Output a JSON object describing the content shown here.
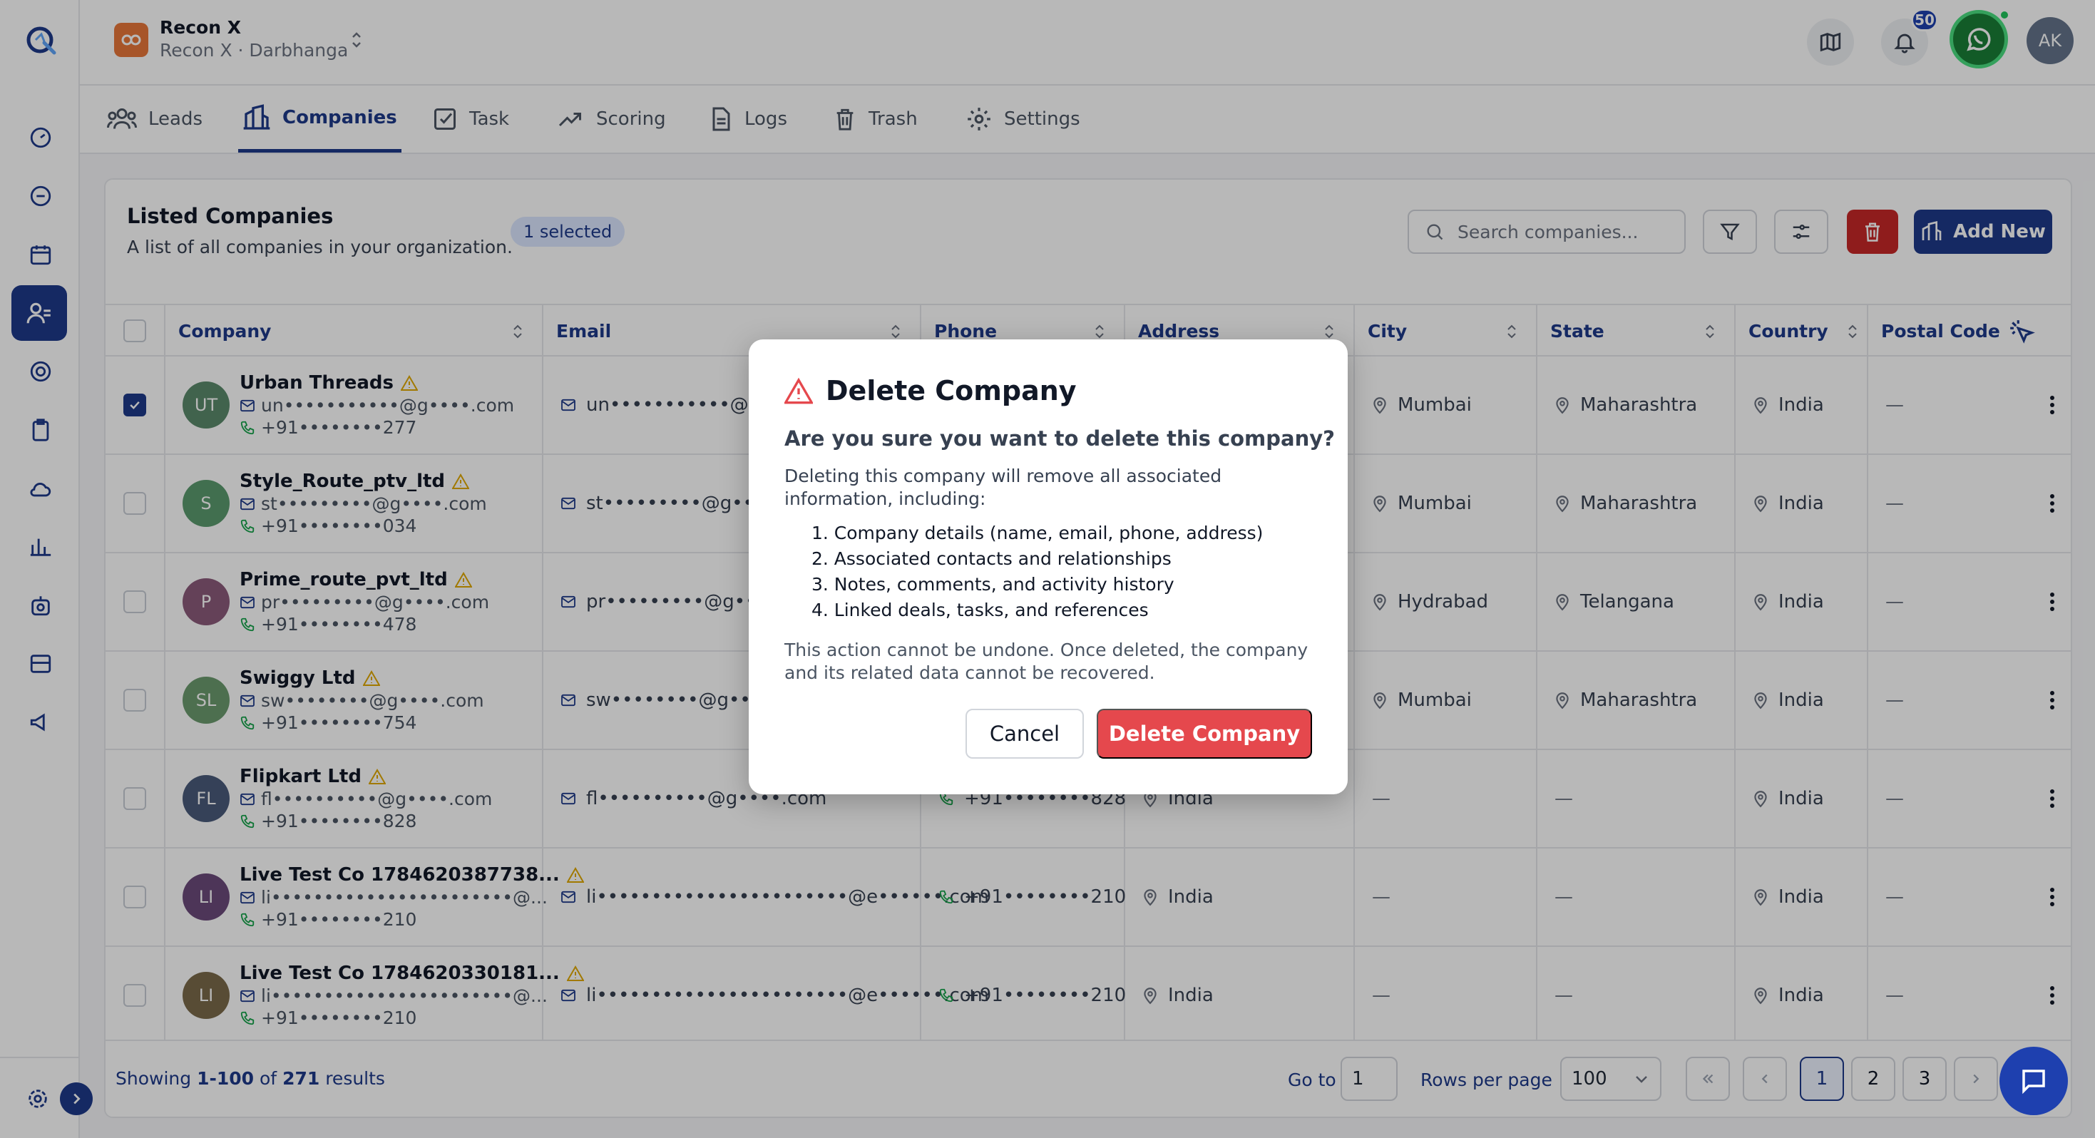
{
  "org": {
    "name": "Recon X",
    "sub": "Recon X · Darbhanga"
  },
  "header": {
    "notif_count": "50",
    "avatar": "AK"
  },
  "tabs": [
    {
      "label": "Leads"
    },
    {
      "label": "Companies"
    },
    {
      "label": "Task"
    },
    {
      "label": "Scoring"
    },
    {
      "label": "Logs"
    },
    {
      "label": "Trash"
    },
    {
      "label": "Settings"
    }
  ],
  "card": {
    "title": "Listed Companies",
    "subtitle": "A list of all companies in your organization.",
    "selected": "1 selected",
    "search_placeholder": "Search companies...",
    "add_label": "Add New"
  },
  "columns": [
    "Company",
    "Email",
    "Phone",
    "Address",
    "City",
    "State",
    "Country",
    "Postal Code"
  ],
  "rows": [
    {
      "initials": "UT",
      "color": "#5b8a6b",
      "name": "Urban Threads",
      "email_short": "un•••••••••••@g••••.com",
      "phone_short": "+91••••••••277",
      "email": "un•••••••••••@g••••.com",
      "phone": "",
      "address": "",
      "city": "Mumbai",
      "state": "Maharashtra",
      "country": "India",
      "postal": "—",
      "checked": true
    },
    {
      "initials": "S",
      "color": "#5b9a6e",
      "name": "Style_Route_ptv_ltd",
      "email_short": "st•••••••••@g••••.com",
      "phone_short": "+91••••••••034",
      "email": "st•••••••••@g••••.com",
      "phone": "",
      "address": "",
      "city": "Mumbai",
      "state": "Maharashtra",
      "country": "India",
      "postal": "—",
      "checked": false
    },
    {
      "initials": "P",
      "color": "#8b5a7a",
      "name": "Prime_route_pvt_ltd",
      "email_short": "pr•••••••••@g••••.com",
      "phone_short": "+91••••••••478",
      "email": "pr•••••••••@g••••.com",
      "phone": "",
      "address": "",
      "city": "Hydrabad",
      "state": "Telangana",
      "country": "India",
      "postal": "—",
      "checked": false
    },
    {
      "initials": "SL",
      "color": "#6b9a6e",
      "name": "Swiggy Ltd",
      "email_short": "sw••••••••@g••••.com",
      "phone_short": "+91••••••••754",
      "email": "sw••••••••@g••••.com",
      "phone": "",
      "address": "",
      "city": "Mumbai",
      "state": "Maharashtra",
      "country": "India",
      "postal": "—",
      "checked": false
    },
    {
      "initials": "FL",
      "color": "#4a5a7a",
      "name": "Flipkart Ltd",
      "email_short": "fl••••••••••@g••••.com",
      "phone_short": "+91••••••••828",
      "email": "fl••••••••••@g••••.com",
      "phone": "+91••••••••828",
      "address": "India",
      "city": "—",
      "state": "—",
      "country": "India",
      "postal": "—",
      "checked": false
    },
    {
      "initials": "LI",
      "color": "#6b4a7a",
      "name": "Live Test Co 1784620387738...",
      "email_short": "li•••••••••••••••••••••••@...",
      "phone_short": "+91••••••••210",
      "email": "li•••••••••••••••••••••••@e••••••.com",
      "phone": "+91••••••••210",
      "address": "India",
      "city": "—",
      "state": "—",
      "country": "India",
      "postal": "—",
      "checked": false
    },
    {
      "initials": "LI",
      "color": "#7a6a4a",
      "name": "Live Test Co 1784620330181...",
      "email_short": "li•••••••••••••••••••••••@...",
      "phone_short": "+91••••••••210",
      "email": "li•••••••••••••••••••••••@e••••••.com",
      "phone": "+91••••••••210",
      "address": "India",
      "city": "—",
      "state": "—",
      "country": "India",
      "postal": "—",
      "checked": false
    }
  ],
  "footer": {
    "showing_prefix": "Showing",
    "range": "1-100",
    "of": "of",
    "total": "271",
    "results": "results",
    "goto_label": "Go to",
    "goto_value": "1",
    "rpp_label": "Rows per page",
    "rpp_value": "100",
    "pages": [
      "1",
      "2",
      "3"
    ]
  },
  "modal": {
    "title": "Delete Company",
    "question": "Are you sure you want to delete this company?",
    "intro": "Deleting this company will remove all associated information, including:",
    "items": [
      "1. Company details (name, email, phone, address)",
      "2. Associated contacts and relationships",
      "3. Notes, comments, and activity history",
      "4. Linked deals, tasks, and references"
    ],
    "note": "This action cannot be undone. Once deleted, the company and its related data cannot be recovered.",
    "cancel": "Cancel",
    "confirm": "Delete Company"
  },
  "colors": {
    "primary": "#1e3a8a",
    "danger": "#e5484d",
    "warning": "#e0a800"
  }
}
